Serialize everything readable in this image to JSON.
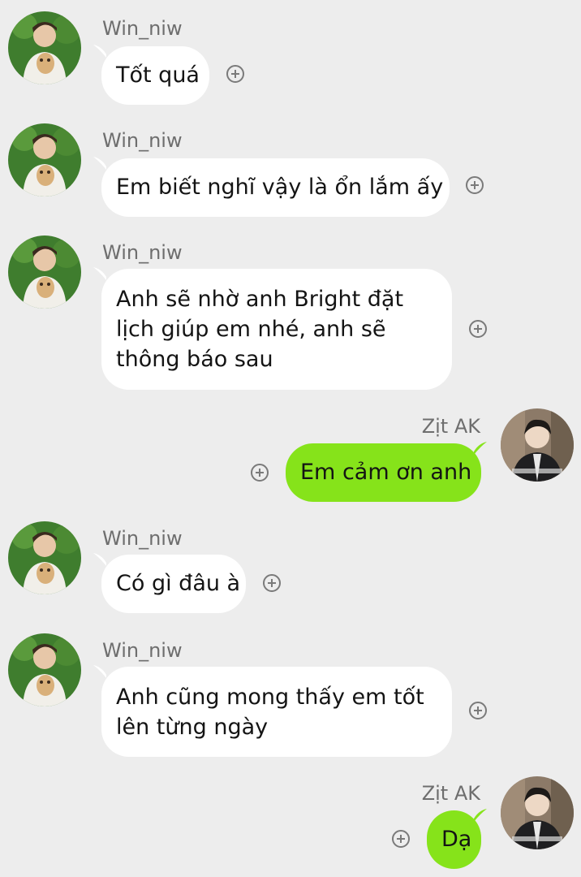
{
  "contacts": {
    "other_name": "Win_niw",
    "self_name": "Zịt AK"
  },
  "colors": {
    "background": "#ededed",
    "incoming_bubble": "#ffffff",
    "outgoing_bubble": "#86e31a",
    "name_text": "#6e6e6e",
    "message_text": "#141414"
  },
  "messages": [
    {
      "sender": "Win_niw",
      "direction": "incoming",
      "text": "Tốt quá"
    },
    {
      "sender": "Win_niw",
      "direction": "incoming",
      "text": "Em biết nghĩ vậy là ổn lắm ấy"
    },
    {
      "sender": "Win_niw",
      "direction": "incoming",
      "text": "Anh sẽ nhờ anh Bright đặt lịch giúp em nhé, anh sẽ thông báo sau"
    },
    {
      "sender": "Zịt AK",
      "direction": "outgoing",
      "text": "Em cảm ơn anh"
    },
    {
      "sender": "Win_niw",
      "direction": "incoming",
      "text": "Có gì đâu à"
    },
    {
      "sender": "Win_niw",
      "direction": "incoming",
      "text": "Anh cũng mong thấy em tốt lên từng ngày"
    },
    {
      "sender": "Zịt AK",
      "direction": "outgoing",
      "text": "Dạ"
    }
  ],
  "icons": {
    "react": "add-reaction-icon",
    "other_avatar": "avatar-win-niw",
    "self_avatar": "avatar-zit-ak"
  }
}
